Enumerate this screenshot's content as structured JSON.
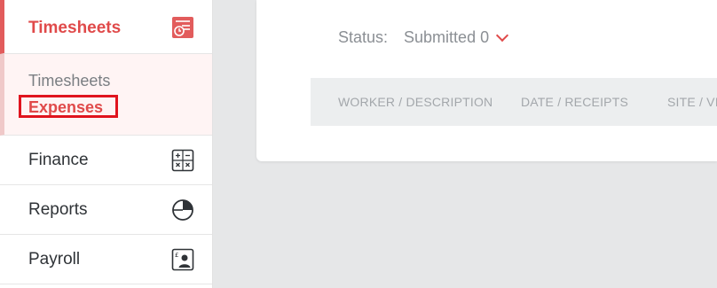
{
  "sidebar": {
    "active_section": "Timesheets",
    "sub_items": [
      "Timesheets",
      "Expenses"
    ],
    "items": [
      {
        "label": "Finance",
        "icon": "calculator-icon"
      },
      {
        "label": "Reports",
        "icon": "pie-chart-icon"
      },
      {
        "label": "Payroll",
        "icon": "payroll-id-icon"
      }
    ]
  },
  "main": {
    "status_label": "Status:",
    "status_value": "Submitted 0",
    "columns": [
      "WORKER / DESCRIPTION",
      "DATE / RECEIPTS",
      "SITE / VI"
    ]
  },
  "colors": {
    "accent": "#e04a4a",
    "highlight": "#e0141e"
  }
}
